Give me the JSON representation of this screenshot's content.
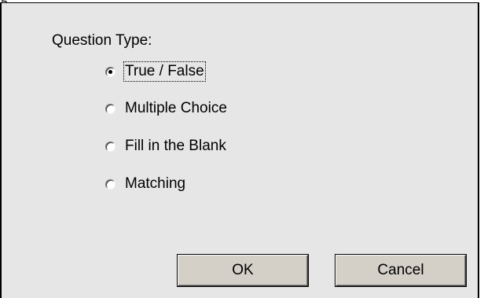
{
  "top_fragment": "g",
  "dialog": {
    "group_label": "Question Type:",
    "options": [
      {
        "label": "True / False",
        "checked": true,
        "focused": true
      },
      {
        "label": "Multiple Choice",
        "checked": false,
        "focused": false
      },
      {
        "label": "Fill in the Blank",
        "checked": false,
        "focused": false
      },
      {
        "label": "Matching",
        "checked": false,
        "focused": false
      }
    ],
    "ok_label": "OK",
    "cancel_label": "Cancel"
  }
}
